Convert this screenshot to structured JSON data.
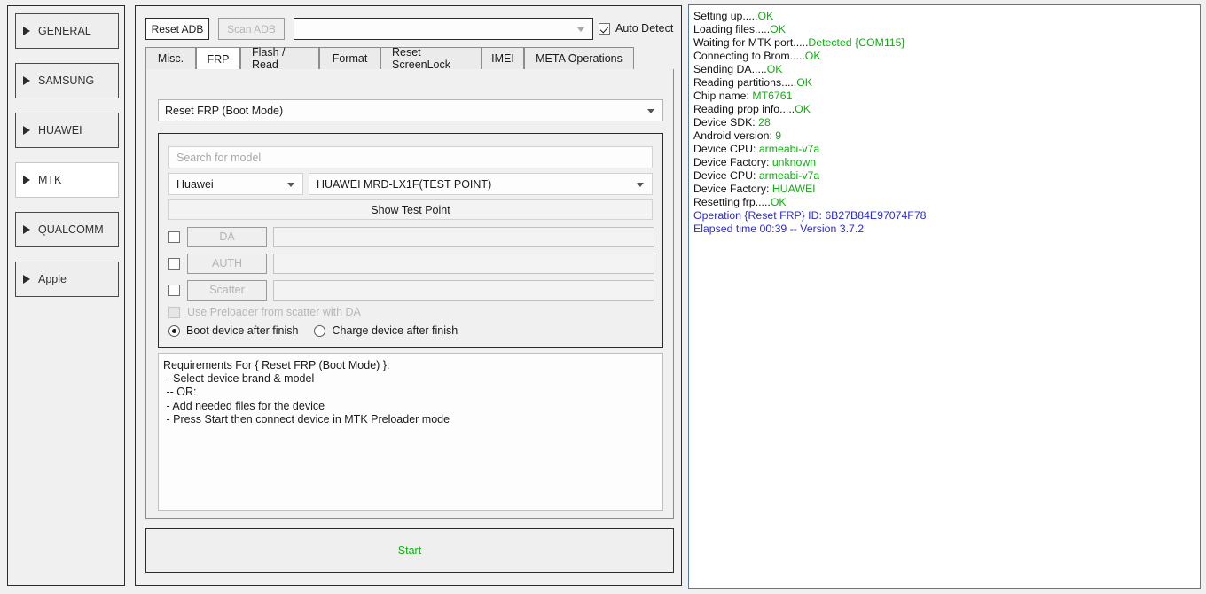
{
  "sidebar": {
    "items": [
      {
        "label": "GENERAL",
        "active": false
      },
      {
        "label": "SAMSUNG",
        "active": false
      },
      {
        "label": "HUAWEI",
        "active": false
      },
      {
        "label": "MTK",
        "active": true
      },
      {
        "label": "QUALCOMM",
        "active": false
      },
      {
        "label": "Apple",
        "active": false
      }
    ]
  },
  "toolbar": {
    "reset_adb_label": "Reset ADB",
    "scan_adb_label": "Scan ADB",
    "device_combo_value": "",
    "auto_detect_label": "Auto Detect",
    "auto_detect_checked": true
  },
  "tabs": [
    {
      "label": "Misc.",
      "active": false
    },
    {
      "label": "FRP",
      "active": true
    },
    {
      "label": "Flash / Read",
      "active": false
    },
    {
      "label": "Format",
      "active": false
    },
    {
      "label": "Reset ScreenLock",
      "active": false
    },
    {
      "label": "IMEI",
      "active": false
    },
    {
      "label": "META Operations",
      "active": false
    }
  ],
  "frp": {
    "operation_value": "Reset FRP (Boot Mode)",
    "search_placeholder": "Search for model",
    "brand_value": "Huawei",
    "model_value": "HUAWEI MRD-LX1F(TEST POINT)",
    "show_test_point_label": "Show Test Point",
    "file_rows": [
      {
        "button": "DA",
        "value": "",
        "checked": false
      },
      {
        "button": "AUTH",
        "value": "",
        "checked": false
      },
      {
        "button": "Scatter",
        "value": "",
        "checked": false
      }
    ],
    "preloader_label": "Use Preloader from scatter with DA",
    "preloader_checked": false,
    "radio_boot_label": "Boot device after finish",
    "radio_charge_label": "Charge device after finish",
    "radio_selected": "boot",
    "requirements": [
      "Requirements For { Reset FRP (Boot Mode) }:",
      " - Select device brand & model",
      " -- OR:",
      " - Add needed files for the device",
      " - Press Start then connect device in MTK Preloader mode"
    ]
  },
  "start_button": {
    "label": "Start",
    "color": "#0fb00f"
  },
  "log": {
    "lines": [
      {
        "text": "Setting up.....",
        "value": "OK",
        "color": "green"
      },
      {
        "text": "Loading files.....",
        "value": "OK",
        "color": "green"
      },
      {
        "text": "Waiting for MTK port.....",
        "value": "Detected {COM115}",
        "color": "green"
      },
      {
        "text": "Connecting to Brom.....",
        "value": "OK",
        "color": "green"
      },
      {
        "text": "Sending DA.....",
        "value": "OK",
        "color": "green"
      },
      {
        "text": "Reading partitions.....",
        "value": "OK",
        "color": "green"
      },
      {
        "text": "Chip name: ",
        "value": "MT6761",
        "color": "green"
      },
      {
        "text": "Reading prop info.....",
        "value": "OK",
        "color": "green"
      },
      {
        "text": "Device SDK: ",
        "value": "28",
        "color": "green"
      },
      {
        "text": "Android version: ",
        "value": "9",
        "color": "green"
      },
      {
        "text": "Device CPU: ",
        "value": "armeabi-v7a",
        "color": "green"
      },
      {
        "text": "Device Factory: ",
        "value": "unknown",
        "color": "green"
      },
      {
        "text": "Device CPU: ",
        "value": "armeabi-v7a",
        "color": "green"
      },
      {
        "text": "Device Factory: ",
        "value": "HUAWEI",
        "color": "green"
      },
      {
        "text": "Resetting frp.....",
        "value": "OK",
        "color": "green"
      },
      {
        "text": "Operation {Reset FRP} ID: 6B27B84E97074F78",
        "value": "",
        "color": "blue"
      },
      {
        "text": "Elapsed time 00:39 -- Version 3.7.2",
        "value": "",
        "color": "blue"
      }
    ],
    "green_hex": "#0fae0f",
    "blue_hex": "#2a2ae0"
  }
}
